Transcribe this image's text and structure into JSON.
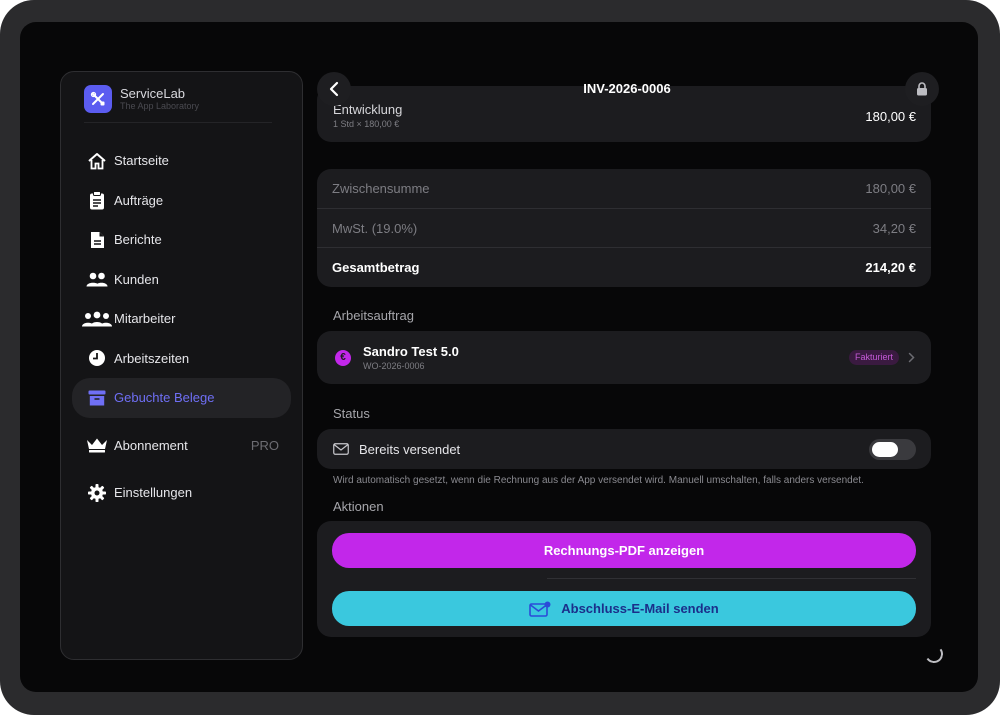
{
  "sidebar": {
    "brand_name": "ServiceLab",
    "brand_sub": "The App Laboratory",
    "items": [
      {
        "label": "Startseite",
        "icon": "home-icon"
      },
      {
        "label": "Aufträge",
        "icon": "clipboard-icon"
      },
      {
        "label": "Berichte",
        "icon": "document-icon"
      },
      {
        "label": "Kunden",
        "icon": "users-icon"
      },
      {
        "label": "Mitarbeiter",
        "icon": "team-icon"
      },
      {
        "label": "Arbeitszeiten",
        "icon": "clock-icon"
      },
      {
        "label": "Gebuchte Belege",
        "icon": "archive-box-icon",
        "active": true
      },
      {
        "label": "Abonnement",
        "icon": "crown-icon",
        "badge": "PRO"
      },
      {
        "label": "Einstellungen",
        "icon": "gear-icon"
      }
    ]
  },
  "header": {
    "title": "INV-2026-0006"
  },
  "line_item": {
    "name": "Entwicklung",
    "detail": "1 Std × 180,00 €",
    "amount": "180,00 €"
  },
  "totals": {
    "subtotal_label": "Zwischensumme",
    "subtotal_value": "180,00 €",
    "tax_label": "MwSt. (19.0%)",
    "tax_value": "34,20 €",
    "total_label": "Gesamtbetrag",
    "total_value": "214,20 €"
  },
  "work_order": {
    "section": "Arbeitsauftrag",
    "title": "Sandro Test 5.0",
    "number": "WO-2026-0006",
    "badge": "Fakturiert"
  },
  "status": {
    "section": "Status",
    "sent_label": "Bereits versendet",
    "sent_on": false,
    "hint": "Wird automatisch gesetzt, wenn die Rechnung aus der App versendet wird. Manuell umschalten, falls anders versendet."
  },
  "actions": {
    "section": "Aktionen",
    "pdf_label": "Rechnungs-PDF anzeigen",
    "email_label": "Abschluss-E-Mail senden"
  },
  "colors": {
    "accent": "#6f6ff5",
    "pdf_button": "#c227ea",
    "email_button": "#3ac8de",
    "badge_bg": "#3a1a40",
    "badge_text": "#c45ad6"
  }
}
